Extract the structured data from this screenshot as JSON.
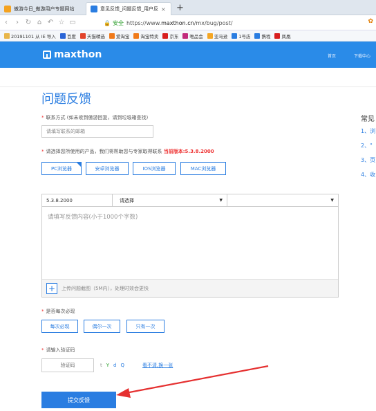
{
  "browser": {
    "tabs": [
      {
        "label": "傲游今日_傲游用户专题网站",
        "active": false
      },
      {
        "label": "意见反馈_问题反馈_用户反",
        "active": true
      }
    ],
    "new_tab": "+",
    "url_secure": "安全",
    "url_prefix": "https://www.",
    "url_host": "maxthon.cn",
    "url_path": "/mx/bug/post/",
    "bookmarks": [
      {
        "label": "20191101 从 IE 导入",
        "icon_color": "#e8b64a"
      },
      {
        "label": "百度",
        "icon_color": "#2a64d6"
      },
      {
        "label": "天猫精选",
        "icon_color": "#e2432b"
      },
      {
        "label": "爱淘宝",
        "icon_color": "#f07a1a"
      },
      {
        "label": "淘宝特卖",
        "icon_color": "#f07a1a"
      },
      {
        "label": "京东",
        "icon_color": "#d81e1e"
      },
      {
        "label": "唯品会",
        "icon_color": "#c22b7c"
      },
      {
        "label": "亚马逊",
        "icon_color": "#f5a623"
      },
      {
        "label": "1号店",
        "icon_color": "#2a7de1"
      },
      {
        "label": "携程",
        "icon_color": "#2a7de1"
      },
      {
        "label": "凤凰",
        "icon_color": "#d81e1e"
      }
    ]
  },
  "site": {
    "logo": "maxthon",
    "nav": [
      "首页",
      "下载中心"
    ]
  },
  "page": {
    "title": "问题反馈",
    "contact_label": "联系方式 (如未收到傲游回复，请到垃圾箱查找)",
    "contact_placeholder": "请填写联系的邮箱",
    "product_label": "请选择您所使用的产品，我们将帮助您与专家取得联系",
    "version_hint": "当前版本:5.3.8.2000",
    "products": [
      "PC浏览器",
      "安卓浏览器",
      "IOS浏览器",
      "MAC浏览器"
    ],
    "version_value": "5.3.8.2000",
    "select_placeholder": "请选择",
    "content_placeholder": "请填写反馈内容(小于1000个字数)",
    "upload_hint": "上传问题截图（5M内），处理时效会更快",
    "frequency_label": "是否每次必现",
    "frequency_options": [
      "每次必现",
      "偶尔一次",
      "只有一次"
    ],
    "captcha_label": "请输入验证码",
    "captcha_placeholder": "验证码",
    "captcha_chars": [
      "t",
      "Y",
      "d",
      "Q"
    ],
    "captcha_refresh": "看不清,换一张",
    "submit": "提交反馈"
  },
  "sidebar": {
    "title": "常见",
    "items": [
      "1、浏",
      "2、\"",
      "3、页",
      "4、收"
    ]
  },
  "colors": {
    "brand_blue": "#2a8be8",
    "link_blue": "#2a7de1",
    "required_red": "#e33333",
    "annotation_arrow": "#e53030"
  }
}
